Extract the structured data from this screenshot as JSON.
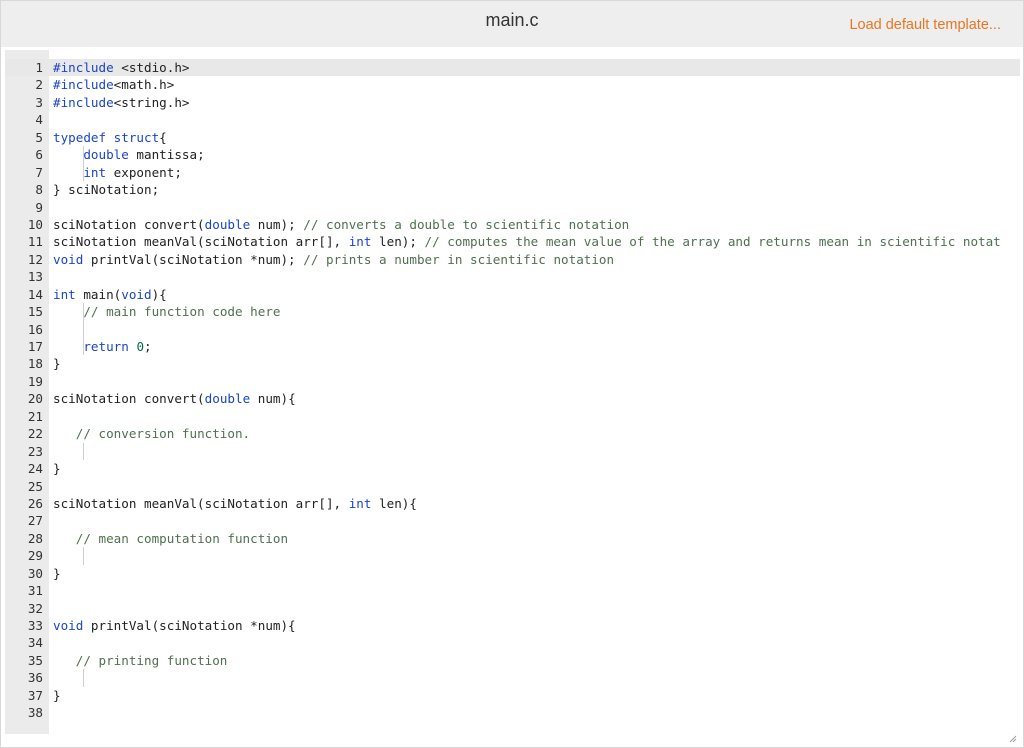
{
  "header": {
    "file_name": "main.c",
    "load_template_label": "Load default template..."
  },
  "editor": {
    "language": "c",
    "active_line": 1,
    "colors": {
      "keyword": "#1a44cc",
      "comment": "#507050",
      "number": "#116644",
      "link": "#e87722"
    },
    "lines": [
      {
        "n": "1",
        "tokens": [
          {
            "t": "kw",
            "v": "#include"
          },
          {
            "t": "",
            "v": " <stdio.h>"
          }
        ]
      },
      {
        "n": "2",
        "tokens": [
          {
            "t": "kw",
            "v": "#include"
          },
          {
            "t": "",
            "v": "<math.h>"
          }
        ]
      },
      {
        "n": "3",
        "tokens": [
          {
            "t": "kw",
            "v": "#include"
          },
          {
            "t": "",
            "v": "<string.h>"
          }
        ]
      },
      {
        "n": "4",
        "tokens": []
      },
      {
        "n": "5",
        "tokens": [
          {
            "t": "kw",
            "v": "typedef struct"
          },
          {
            "t": "",
            "v": "{"
          }
        ]
      },
      {
        "n": "6",
        "guide": true,
        "tokens": [
          {
            "t": "",
            "v": "    "
          },
          {
            "t": "kw",
            "v": "double"
          },
          {
            "t": "",
            "v": " mantissa;"
          }
        ]
      },
      {
        "n": "7",
        "guide": true,
        "tokens": [
          {
            "t": "",
            "v": "    "
          },
          {
            "t": "kw",
            "v": "int"
          },
          {
            "t": "",
            "v": " exponent;"
          }
        ]
      },
      {
        "n": "8",
        "tokens": [
          {
            "t": "",
            "v": "} sciNotation;"
          }
        ]
      },
      {
        "n": "9",
        "tokens": []
      },
      {
        "n": "10",
        "tokens": [
          {
            "t": "",
            "v": "sciNotation convert("
          },
          {
            "t": "kw",
            "v": "double"
          },
          {
            "t": "",
            "v": " num); "
          },
          {
            "t": "cm",
            "v": "// converts a double to scientific notation"
          }
        ]
      },
      {
        "n": "11",
        "tokens": [
          {
            "t": "",
            "v": "sciNotation meanVal(sciNotation arr[], "
          },
          {
            "t": "kw",
            "v": "int"
          },
          {
            "t": "",
            "v": " len); "
          },
          {
            "t": "cm",
            "v": "// computes the mean value of the array and returns mean in scientific notat"
          }
        ]
      },
      {
        "n": "12",
        "tokens": [
          {
            "t": "kw",
            "v": "void"
          },
          {
            "t": "",
            "v": " printVal(sciNotation *num); "
          },
          {
            "t": "cm",
            "v": "// prints a number in scientific notation"
          }
        ]
      },
      {
        "n": "13",
        "tokens": []
      },
      {
        "n": "14",
        "tokens": [
          {
            "t": "kw",
            "v": "int"
          },
          {
            "t": "",
            "v": " main("
          },
          {
            "t": "kw",
            "v": "void"
          },
          {
            "t": "",
            "v": "){"
          }
        ]
      },
      {
        "n": "15",
        "guide": true,
        "tokens": [
          {
            "t": "",
            "v": "    "
          },
          {
            "t": "cm",
            "v": "// main function code here"
          }
        ]
      },
      {
        "n": "16",
        "guide": true,
        "tokens": []
      },
      {
        "n": "17",
        "guide": true,
        "tokens": [
          {
            "t": "",
            "v": "    "
          },
          {
            "t": "kw",
            "v": "return"
          },
          {
            "t": "",
            "v": " "
          },
          {
            "t": "num",
            "v": "0"
          },
          {
            "t": "",
            "v": ";"
          }
        ]
      },
      {
        "n": "18",
        "tokens": [
          {
            "t": "",
            "v": "}"
          }
        ]
      },
      {
        "n": "19",
        "tokens": []
      },
      {
        "n": "20",
        "tokens": [
          {
            "t": "",
            "v": "sciNotation convert("
          },
          {
            "t": "kw",
            "v": "double"
          },
          {
            "t": "",
            "v": " num){"
          }
        ]
      },
      {
        "n": "21",
        "tokens": []
      },
      {
        "n": "22",
        "tokens": [
          {
            "t": "",
            "v": "   "
          },
          {
            "t": "cm",
            "v": "// conversion function."
          }
        ]
      },
      {
        "n": "23",
        "guide": true,
        "tokens": []
      },
      {
        "n": "24",
        "tokens": [
          {
            "t": "",
            "v": "}"
          }
        ]
      },
      {
        "n": "25",
        "tokens": []
      },
      {
        "n": "26",
        "tokens": [
          {
            "t": "",
            "v": "sciNotation meanVal(sciNotation arr[], "
          },
          {
            "t": "kw",
            "v": "int"
          },
          {
            "t": "",
            "v": " len){"
          }
        ]
      },
      {
        "n": "27",
        "tokens": []
      },
      {
        "n": "28",
        "tokens": [
          {
            "t": "",
            "v": "   "
          },
          {
            "t": "cm",
            "v": "// mean computation function"
          }
        ]
      },
      {
        "n": "29",
        "guide": true,
        "tokens": []
      },
      {
        "n": "30",
        "tokens": [
          {
            "t": "",
            "v": "}"
          }
        ]
      },
      {
        "n": "31",
        "tokens": []
      },
      {
        "n": "32",
        "tokens": []
      },
      {
        "n": "33",
        "tokens": [
          {
            "t": "kw",
            "v": "void"
          },
          {
            "t": "",
            "v": " printVal(sciNotation *num){"
          }
        ]
      },
      {
        "n": "34",
        "tokens": []
      },
      {
        "n": "35",
        "tokens": [
          {
            "t": "",
            "v": "   "
          },
          {
            "t": "cm",
            "v": "// printing function"
          }
        ]
      },
      {
        "n": "36",
        "guide": true,
        "tokens": []
      },
      {
        "n": "37",
        "tokens": [
          {
            "t": "",
            "v": "}"
          }
        ]
      },
      {
        "n": "38",
        "tokens": []
      }
    ]
  },
  "icons": {
    "resize_handle": "resize-grip-icon"
  }
}
